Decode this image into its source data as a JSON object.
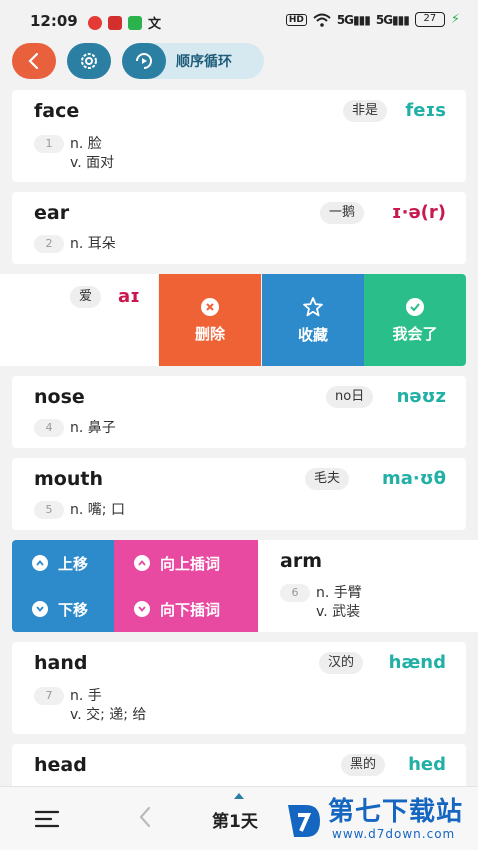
{
  "status_bar": {
    "time": "12:09",
    "battery": "27",
    "signal_1": "5G",
    "signal_2": "5G",
    "hd": "HD"
  },
  "toolbar": {
    "loop_label": "顺序循环"
  },
  "words": [
    {
      "word": "face",
      "hint": "非是",
      "ipa": "feɪs",
      "index": "1",
      "defs": [
        "n. 脸",
        "v. 面对"
      ]
    },
    {
      "word": "ear",
      "hint": "一鹅",
      "ipa": "ɪ·ə(r)",
      "index": "2",
      "defs": [
        "n. 耳朵"
      ]
    },
    {
      "hint": "爱",
      "ipa": "aɪ"
    },
    {
      "word": "nose",
      "hint": "no日",
      "ipa": "nəʊz",
      "index": "4",
      "defs": [
        "n. 鼻子"
      ]
    },
    {
      "word": "mouth",
      "hint": "毛夫",
      "ipa": "ma·ʊθ",
      "index": "5",
      "defs": [
        "n. 嘴; 口"
      ]
    },
    {
      "word": "arm",
      "index": "6",
      "defs": [
        "n. 手臂",
        "v. 武装"
      ]
    },
    {
      "word": "hand",
      "hint": "汉的",
      "ipa": "hænd",
      "index": "7",
      "defs": [
        "n. 手",
        "v. 交; 递; 给"
      ]
    },
    {
      "word": "head",
      "hint": "黑的",
      "ipa": "hed"
    }
  ],
  "swipe_actions": {
    "delete": "删除",
    "favorite": "收藏",
    "known": "我会了"
  },
  "move_actions": {
    "move_up": "上移",
    "move_down": "下移",
    "insert_up": "向上插词",
    "insert_down": "向下插词"
  },
  "bottom_bar": {
    "day_label": "第1天"
  },
  "watermark": {
    "title": "第七下载站",
    "url": "www.d7down.com"
  },
  "colors": {
    "accent": "#2a7fa3",
    "back": "#e8603c",
    "delete": "#ef6236",
    "favorite": "#2d8bcc",
    "known": "#29be8a",
    "insert": "#e84aa1",
    "ipa": "#22b0a6",
    "ipa_alt": "#c8194f"
  }
}
